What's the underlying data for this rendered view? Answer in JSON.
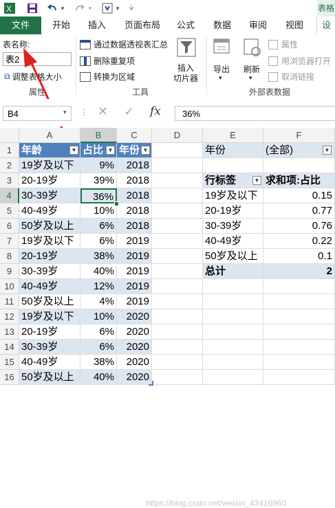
{
  "tabs": [
    "文件",
    "开始",
    "插入",
    "页面布局",
    "公式",
    "数据",
    "审阅",
    "视图",
    "设"
  ],
  "corner_tab": "表格",
  "ribbon": {
    "table_name_label": "表名称:",
    "table_name_value": "表2",
    "resize_label": "调整表格大小",
    "props_group": "属性",
    "summarize_pivot": "通过数据透视表汇总",
    "remove_dup": "删除重复项",
    "convert_range": "转换为区域",
    "insert_slicer": "插入\n切片器",
    "insert_slicer_1": "插入",
    "insert_slicer_2": "切片器",
    "tools_group": "工具",
    "export": "导出",
    "refresh": "刷新",
    "properties": "属性",
    "open_browser": "用浏览器打开",
    "unlink": "取消链接",
    "external_group": "外部表数据"
  },
  "formula": {
    "name_box": "B4",
    "value": "36%",
    "fx": "fx"
  },
  "columns": [
    "A",
    "B",
    "C",
    "D",
    "E",
    "F"
  ],
  "rows": [
    "1",
    "2",
    "3",
    "4",
    "5",
    "6",
    "7",
    "8",
    "9",
    "10",
    "11",
    "12",
    "13",
    "14",
    "15",
    "16"
  ],
  "table": {
    "headers": [
      "年龄",
      "占比",
      "年份"
    ],
    "data": [
      [
        "19岁及以下",
        "9%",
        "2018"
      ],
      [
        "20-19岁",
        "39%",
        "2018"
      ],
      [
        "30-39岁",
        "36%",
        "2018"
      ],
      [
        "40-49岁",
        "10%",
        "2018"
      ],
      [
        "50岁及以上",
        "6%",
        "2018"
      ],
      [
        "19岁及以下",
        "6%",
        "2019"
      ],
      [
        "20-19岁",
        "38%",
        "2019"
      ],
      [
        "30-39岁",
        "40%",
        "2019"
      ],
      [
        "40-49岁",
        "12%",
        "2019"
      ],
      [
        "50岁及以上",
        "4%",
        "2019"
      ],
      [
        "19岁及以下",
        "10%",
        "2020"
      ],
      [
        "20-19岁",
        "6%",
        "2020"
      ],
      [
        "30-39岁",
        "6%",
        "2020"
      ],
      [
        "40-49岁",
        "38%",
        "2020"
      ],
      [
        "50岁及以上",
        "40%",
        "2020"
      ]
    ]
  },
  "pivot": {
    "filter_label": "年份",
    "filter_value": "(全部)",
    "row_label": "行标签",
    "value_label": "求和项:占比",
    "rows": [
      [
        "19岁及以下",
        "0.15"
      ],
      [
        "20-19岁",
        "0.77"
      ],
      [
        "30-39岁",
        "0.76"
      ],
      [
        "40-49岁",
        "0.22"
      ],
      [
        "50岁及以上",
        "0.1"
      ]
    ],
    "total_label": "总计",
    "total_value": "2"
  },
  "watermark": "https://blog.csdn.net/weixin_43416960",
  "accent": "#217346",
  "table_header_color": "#4f81bd",
  "band_color": "#dce6f1"
}
